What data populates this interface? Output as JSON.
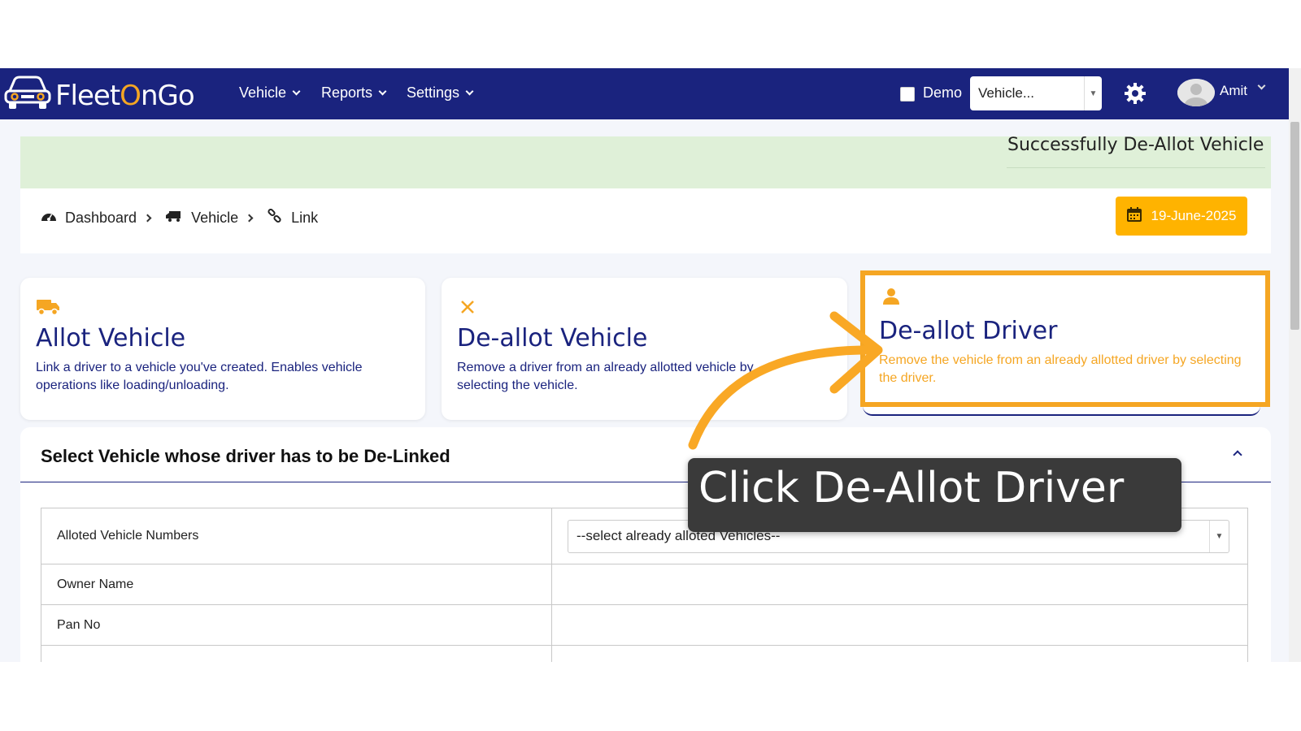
{
  "app": {
    "logo_text_a": "Fleet",
    "logo_text_b": "O",
    "logo_text_c": "nGo"
  },
  "nav": {
    "vehicle": "Vehicle",
    "reports": "Reports",
    "settings": "Settings"
  },
  "header": {
    "demo_label": "Demo",
    "vehicle_select_value": "Vehicle...",
    "user_name": "Amit"
  },
  "alert": {
    "message": "Successfully De-Allot Vehicle"
  },
  "breadcrumb": {
    "items": [
      "Dashboard",
      "Vehicle",
      "Link"
    ]
  },
  "date_button": {
    "label": "19-June-2025"
  },
  "cards": [
    {
      "title": "Allot Vehicle",
      "description": "Link a driver to a vehicle you've created. Enables vehicle operations like loading/unloading.",
      "icon": "truck-icon"
    },
    {
      "title": "De-allot Vehicle",
      "description": "Remove a driver from an already allotted vehicle by selecting the vehicle.",
      "icon": "close-icon"
    },
    {
      "title": "De-allot Driver",
      "description": "Remove the vehicle from an already allotted driver by selecting the driver.",
      "icon": "user-icon"
    }
  ],
  "section": {
    "title": "Select Vehicle whose driver has to be De-Linked",
    "rows": [
      {
        "label": "Alloted Vehicle Numbers",
        "select_value": "--select already alloted Vehicles--"
      },
      {
        "label": "Owner Name"
      },
      {
        "label": "Pan No"
      }
    ]
  },
  "tooltip": {
    "text": "Click De-Allot Driver"
  },
  "colors": {
    "navbar": "#1a237e",
    "accent": "#f5a623",
    "date_button": "#ffb300",
    "alert_bg": "#dff0d8",
    "tooltip_bg": "#3a3a3a"
  }
}
